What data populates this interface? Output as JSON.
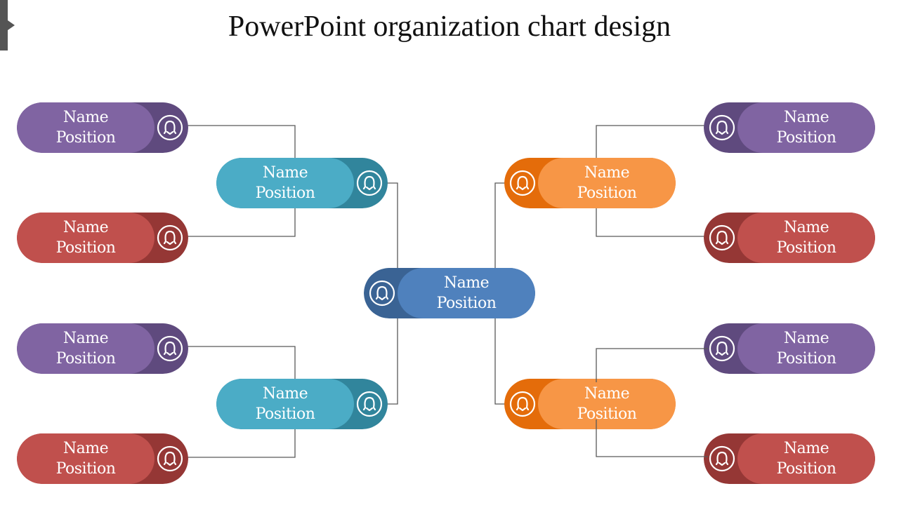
{
  "title": "PowerPoint organization chart design",
  "colors": {
    "purple_light": "#8064A2",
    "purple_dark": "#5F4A7E",
    "red_light": "#C0504D",
    "red_dark": "#953735",
    "teal_light": "#4BACC6",
    "teal_dark": "#31859C",
    "blue_light": "#4F81BD",
    "blue_dark": "#3A6394",
    "orange_light": "#F79646",
    "orange_dark": "#E46C0A",
    "connector": "#595959"
  },
  "nodes": {
    "root": {
      "name": "Name",
      "position": "Position",
      "icon": "user-icon"
    },
    "left_upper_manager": {
      "name": "Name",
      "position": "Position",
      "icon": "user-icon"
    },
    "left_lower_manager": {
      "name": "Name",
      "position": "Position",
      "icon": "user-icon"
    },
    "right_upper_manager": {
      "name": "Name",
      "position": "Position",
      "icon": "user-icon"
    },
    "right_lower_manager": {
      "name": "Name",
      "position": "Position",
      "icon": "user-icon"
    },
    "leaf_l1": {
      "name": "Name",
      "position": "Position",
      "icon": "user-icon"
    },
    "leaf_l2": {
      "name": "Name",
      "position": "Position",
      "icon": "user-icon"
    },
    "leaf_l3": {
      "name": "Name",
      "position": "Position",
      "icon": "user-icon"
    },
    "leaf_l4": {
      "name": "Name",
      "position": "Position",
      "icon": "user-icon"
    },
    "leaf_r1": {
      "name": "Name",
      "position": "Position",
      "icon": "user-icon"
    },
    "leaf_r2": {
      "name": "Name",
      "position": "Position",
      "icon": "user-icon"
    },
    "leaf_r3": {
      "name": "Name",
      "position": "Position",
      "icon": "user-icon"
    },
    "leaf_r4": {
      "name": "Name",
      "position": "Position",
      "icon": "user-icon"
    }
  }
}
